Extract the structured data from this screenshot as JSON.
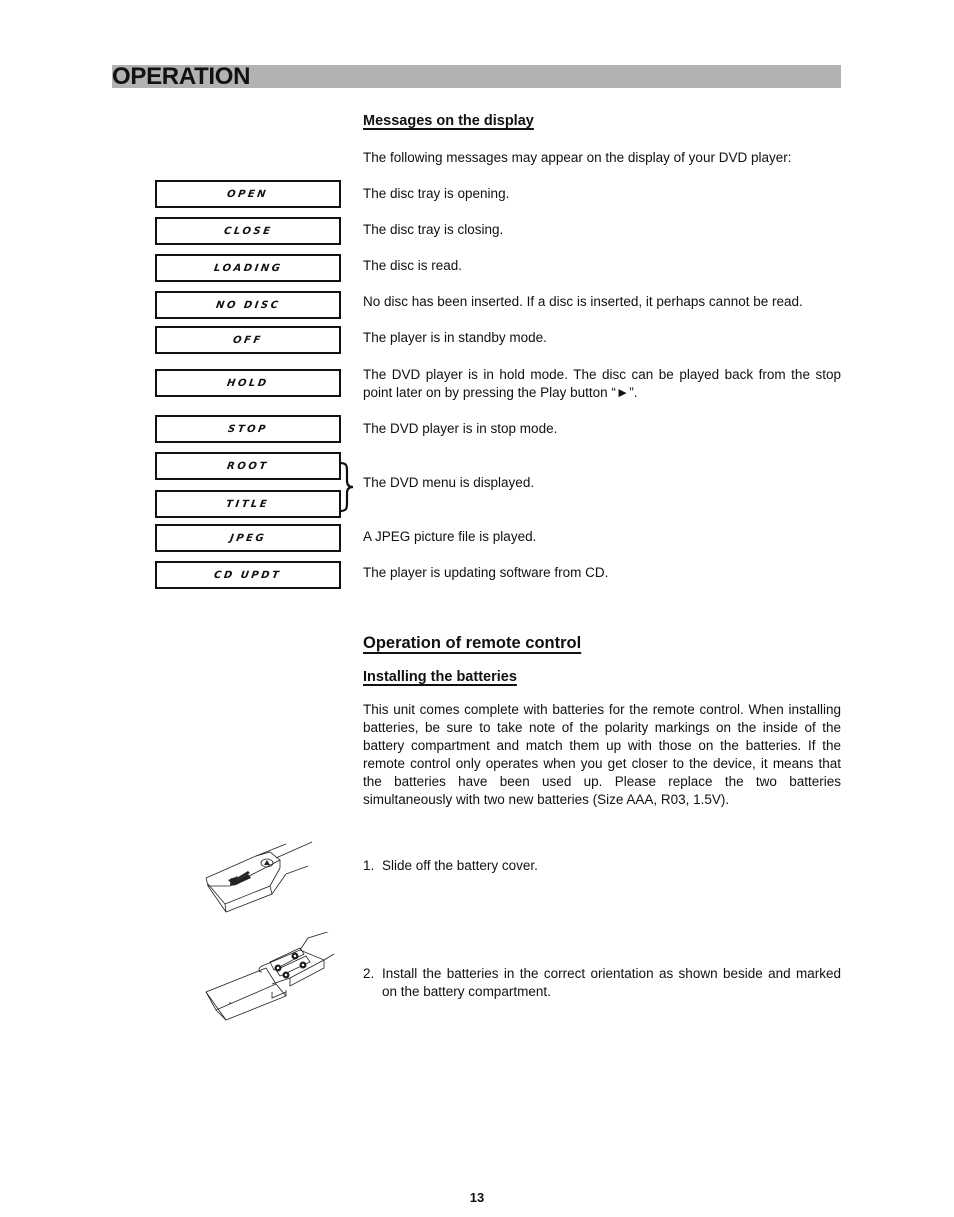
{
  "header": {
    "title": "OPERATION",
    "bar_color": "#b2b2b2"
  },
  "messages_section": {
    "heading": "Messages on the display",
    "intro": "The following messages may appear on the display of your DVD player:",
    "items": [
      {
        "display": "OPEN",
        "description": "The disc tray is opening."
      },
      {
        "display": "CLOSE",
        "description": "The disc tray is closing."
      },
      {
        "display": "LOADING",
        "description": "The disc is read."
      },
      {
        "display": "NO DISC",
        "description": "No disc has been inserted. If a disc is inserted, it perhaps cannot be read."
      },
      {
        "display": "OFF",
        "description": "The player is in standby mode."
      },
      {
        "display": "HOLD",
        "description": "The DVD player is in hold mode. The disc can be played back from the stop point later on by pressing the Play button “►”."
      },
      {
        "display": "STOP",
        "description": "The DVD player is in stop mode."
      },
      {
        "display": "ROOT",
        "description": "The DVD menu is displayed."
      },
      {
        "display": "TITLE",
        "description": ""
      },
      {
        "display": "JPEG",
        "description": "A JPEG picture file is played."
      },
      {
        "display": "CD UPDT",
        "description": "The player is updating software from CD."
      }
    ]
  },
  "remote_section": {
    "heading": "Operation of remote control",
    "subheading": "Installing the batteries",
    "paragraph": "This unit comes complete with batteries for the remote control. When installing batteries, be sure to take note of the polarity markings on the inside of the battery compartment and match them up with those on the batteries. If the remote control only operates when you get closer to the device, it means that the batteries have been used up. Please replace the two batteries simultaneously with two new batteries (Size AAA, R03, 1.5V).",
    "steps": [
      {
        "num": "1.",
        "text": "Slide off the battery cover.",
        "illustration": "remote-battery-cover-slide-illustration"
      },
      {
        "num": "2.",
        "text": "Install the batteries in the correct orientation as shown beside and marked on the battery compartment.",
        "illustration": "remote-battery-compartment-illustration"
      }
    ]
  },
  "footer": {
    "page_number": "13"
  }
}
